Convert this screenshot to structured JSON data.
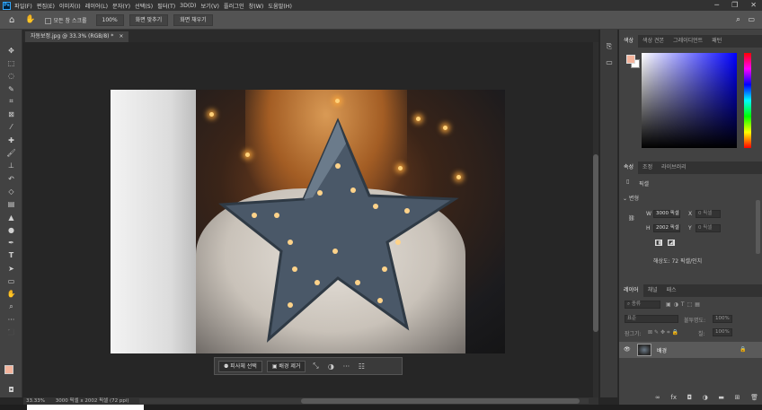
{
  "app": {
    "logo": "Ps",
    "menu": [
      "파일(F)",
      "편집(E)",
      "이미지(I)",
      "레이어(L)",
      "문자(Y)",
      "선택(S)",
      "필터(T)",
      "3D(D)",
      "보기(V)",
      "플러그인",
      "창(W)",
      "도움말(H)"
    ],
    "window_controls": [
      "─",
      "❐",
      "✕"
    ]
  },
  "options_bar": {
    "scroll_all_label": "모든 창 스크롤",
    "zoom_100_label": "100%",
    "fit_screen_label": "화면 맞추기",
    "fill_screen_label": "화면 채우기"
  },
  "document": {
    "tab_label": "자동보정.jpg @ 33.3% (RGB/8) *",
    "tab_close": "×",
    "zoom": "33.33%",
    "doc_info": "3000 픽셀 x 2002 픽셀 (72 ppi)"
  },
  "task_bar": {
    "select_subject_label": "피사체 선택",
    "remove_bg_label": "배경 제거",
    "more_label": "···"
  },
  "color_panel": {
    "tabs": [
      "색상",
      "색상 견본",
      "그레이디언트",
      "패턴"
    ],
    "foreground": "#f4b49c",
    "background": "#ffffff"
  },
  "properties_panel": {
    "tabs": [
      "속성",
      "조정",
      "라이브러리"
    ],
    "pixel_layer_label": "픽셀",
    "section_label": "변형",
    "width_label": "W",
    "width_value": "3000 픽셀",
    "height_label": "H",
    "height_value": "2002 픽셀",
    "x_label": "X",
    "x_value": "0 픽셀",
    "y_label": "Y",
    "y_value": "0 픽셀",
    "resolution_text": "해상도: 72 픽셀/인치"
  },
  "layers_panel": {
    "tabs": [
      "레이어",
      "채널",
      "패스"
    ],
    "filter_placeholder": "종류",
    "blend_mode": "표준",
    "opacity_label": "불투명도:",
    "opacity_value": "100%",
    "lock_label": "잠그기:",
    "fill_label": "칠:",
    "fill_value": "100%",
    "layer_name": "배경"
  }
}
